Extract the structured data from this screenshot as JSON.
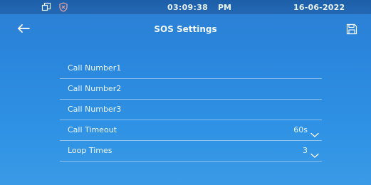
{
  "status_bar": {
    "icons": [
      "windows-icon",
      "shield-x-icon"
    ],
    "time": "03:09:38",
    "ampm": "PM",
    "date": "16-06-2022"
  },
  "header": {
    "title": "SOS Settings",
    "back_icon": "left-arrow-icon",
    "save_icon": "save-icon"
  },
  "settings": [
    {
      "label": "Call Number1",
      "value": ""
    },
    {
      "label": "Call Number2",
      "value": ""
    },
    {
      "label": "Call Number3",
      "value": ""
    },
    {
      "label": "Call Timeout",
      "value": "60s",
      "dropdown": true
    },
    {
      "label": "Loop Times",
      "value": "3",
      "dropdown": true
    }
  ],
  "colors": {
    "background": "#2a86dc",
    "status_bar": "#1d5fa8",
    "text": "#f0f6ff"
  }
}
